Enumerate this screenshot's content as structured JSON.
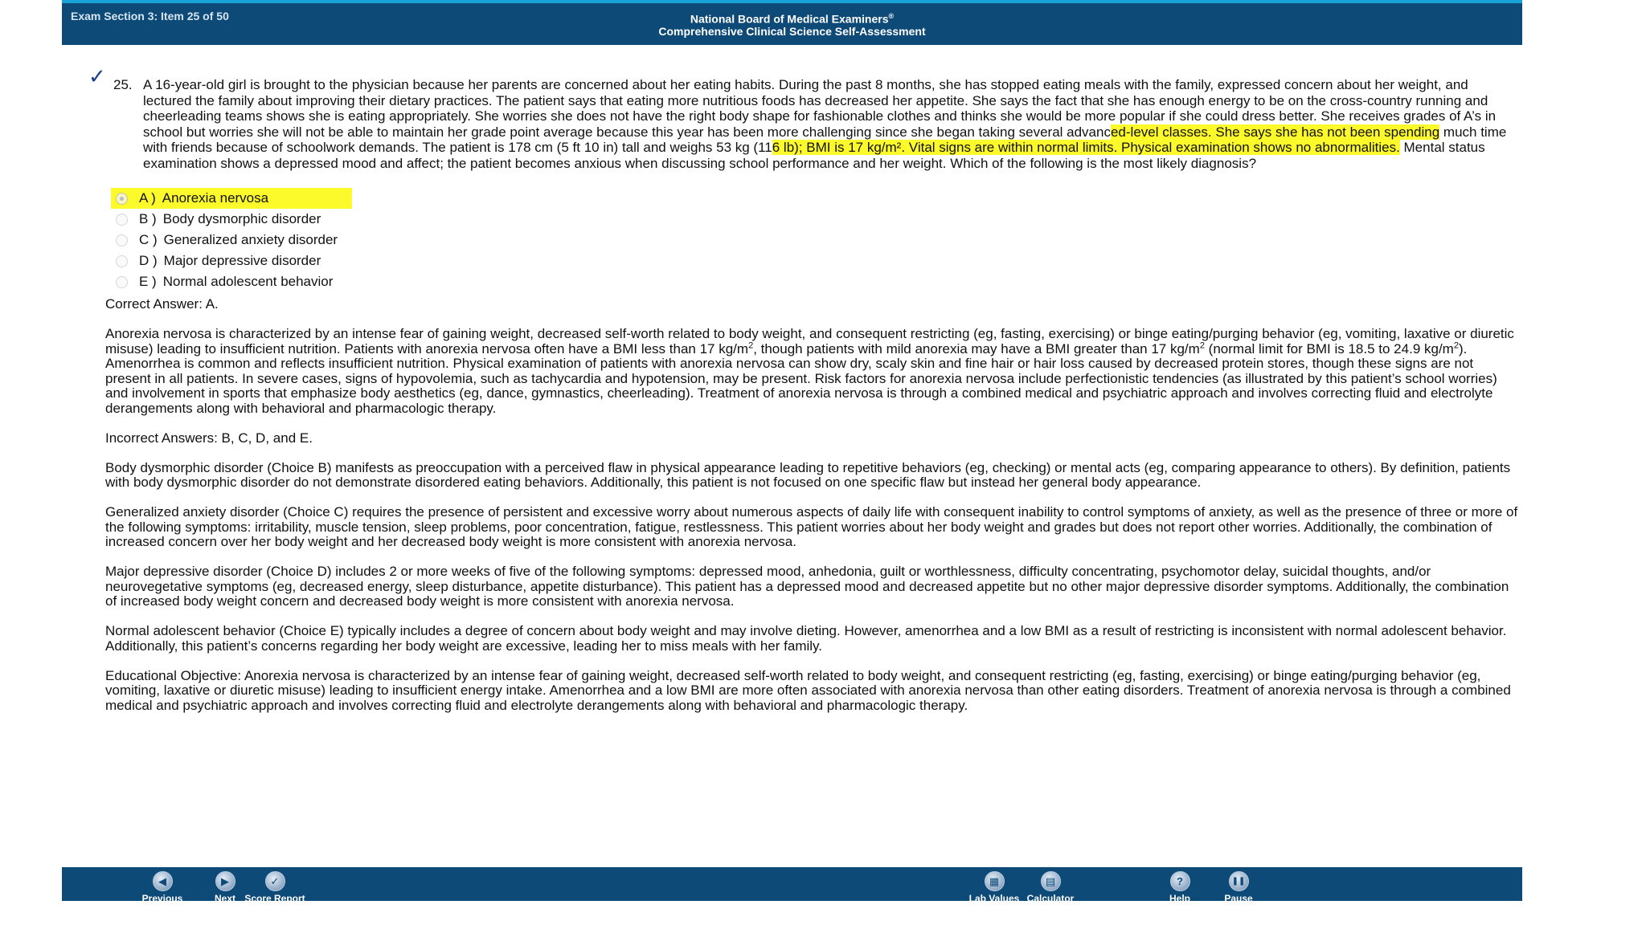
{
  "header": {
    "section_label": "Exam Section 3: Item 25 of 50",
    "title_line1": "National Board of Medical Examiners",
    "title_sup": "®",
    "title_line2": "Comprehensive Clinical Science Self-Assessment"
  },
  "question": {
    "check_mark": "✓",
    "number": "25.",
    "part1": "A 16-year-old girl is brought to the physician because her parents are concerned about her eating habits. During the past 8 months, she has stopped eating meals with the family, expressed concern about her weight, and lectured the family about improving their dietary practices. The patient says that eating more nutritious foods has decreased her appetite. She says the fact that she has enough energy to be on the cross-country running and cheerleading teams shows she is eating appropriately. She worries she does not have the right body shape for fashionable clothes and thinks she would be more popular if she could dress better. She receives grades of A’s in school but worries she will not be able to maintain her grade point average because this year has been more challenging since she began taking several advanc",
    "highlight1": "ed-level classes. She says she has not been spending",
    "part2": " much time with friends because of schoolwork demands. The patient is 178 cm (5 ft 10 in) tall and weighs 53 kg (11",
    "highlight2": "6 lb); BMI is 17 kg/m². Vital signs are within normal limits. Physical examination shows no abnormalities.",
    "part3": " Mental status examination shows a depressed mood and affect; the patient becomes anxious when discussing school performance and her weight. Which of the following is the most likely diagnosis?"
  },
  "options": [
    {
      "letter": "A )",
      "text": "Anorexia nervosa",
      "selected": true
    },
    {
      "letter": "B )",
      "text": "Body dysmorphic disorder",
      "selected": false
    },
    {
      "letter": "C )",
      "text": "Generalized anxiety disorder",
      "selected": false
    },
    {
      "letter": "D )",
      "text": "Major depressive disorder",
      "selected": false
    },
    {
      "letter": "E )",
      "text": "Normal adolescent behavior",
      "selected": false
    }
  ],
  "explanation": {
    "correct_answer": "Correct Answer: A.",
    "an_part1": "Anorexia nervosa is characterized by an intense fear of gaining weight, decreased self-worth related to body weight, and consequent restricting (eg, fasting, exercising) or binge eating/purging behavior (eg, vomiting, laxative or diuretic misuse) leading to insufficient nutrition. Patients with anorexia nervosa often have a BMI less than 17 kg/m",
    "an_part2": ", though patients with mild anorexia may have a BMI greater than 17 kg/m",
    "an_part3": " (normal limit for BMI is 18.5 to 24.9 kg/m",
    "an_part4": "). Amenorrhea is common and reflects insufficient nutrition. Physical examination of patients with anorexia nervosa can show dry, scaly skin and fine hair or hair loss caused by decreased protein stores, though these signs are not present in all patients. In severe cases, signs of hypovolemia, such as tachycardia and hypotension, may be present. Risk factors for anorexia nervosa include perfectionistic tendencies (as illustrated by this patient’s school worries) and involvement in sports that emphasize body aesthetics (eg, dance, gymnastics, cheerleading). Treatment of anorexia nervosa is through a combined medical and psychiatric approach and involves correcting fluid and electrolyte derangements along with behavioral and pharmacologic therapy.",
    "sup2": "2",
    "incorrect_answers": "Incorrect Answers: B, C, D, and E.",
    "choice_b": "Body dysmorphic disorder (Choice B) manifests as preoccupation with a perceived flaw in physical appearance leading to repetitive behaviors (eg, checking) or mental acts (eg, comparing appearance to others). By definition, patients with body dysmorphic disorder do not demonstrate disordered eating behaviors. Additionally, this patient is not focused on one specific flaw but instead her general body appearance.",
    "choice_c": "Generalized anxiety disorder (Choice C) requires the presence of persistent and excessive worry about numerous aspects of daily life with consequent inability to control symptoms of anxiety, as well as the presence of three or more of the following symptoms: irritability, muscle tension, sleep problems, poor concentration, fatigue, restlessness. This patient worries about her body weight and grades but does not report other worries. Additionally, the combination of increased concern over her body weight and her decreased body weight is more consistent with anorexia nervosa.",
    "choice_d": "Major depressive disorder (Choice D) includes 2 or more weeks of five of the following symptoms: depressed mood, anhedonia, guilt or worthlessness, difficulty concentrating, psychomotor delay, suicidal thoughts, and/or neurovegetative symptoms (eg, decreased energy, sleep disturbance, appetite disturbance). This patient has a depressed mood and decreased appetite but no other major depressive disorder symptoms. Additionally, the combination of increased body weight concern and decreased body weight is more consistent with anorexia nervosa.",
    "choice_e": "Normal adolescent behavior (Choice E) typically includes a degree of concern about body weight and may involve dieting. However, amenorrhea and a low BMI as a result of restricting is inconsistent with normal adolescent behavior. Additionally, this patient’s concerns regarding her body weight are excessive, leading her to miss meals with her family.",
    "objective": "Educational Objective: Anorexia nervosa is characterized by an intense fear of gaining weight, decreased self-worth related to body weight, and consequent restricting (eg, fasting, exercising) or binge eating/purging behavior (eg, vomiting, laxative or diuretic misuse) leading to insufficient energy intake. Amenorrhea and a low BMI are more often associated with anorexia nervosa than other eating disorders. Treatment of anorexia nervosa is through a combined medical and psychiatric approach and involves correcting fluid and electrolyte derangements along with behavioral and pharmacologic therapy."
  },
  "toolbar": {
    "previous": {
      "label": "Previous",
      "glyph": "◀"
    },
    "next": {
      "label": "Next",
      "glyph": "▶"
    },
    "score_report": {
      "label": "Score Report",
      "glyph": "✓"
    },
    "lab_values": {
      "label": "Lab Values",
      "glyph": "▦"
    },
    "calculator": {
      "label": "Calculator",
      "glyph": "▤"
    },
    "help": {
      "label": "Help",
      "glyph": "?"
    },
    "pause": {
      "label": "Pause",
      "glyph": "❚❚"
    }
  },
  "colors": {
    "header_bg": "#0d4a78",
    "header_accent": "#18a3d8",
    "highlight": "#fdfa2b"
  }
}
